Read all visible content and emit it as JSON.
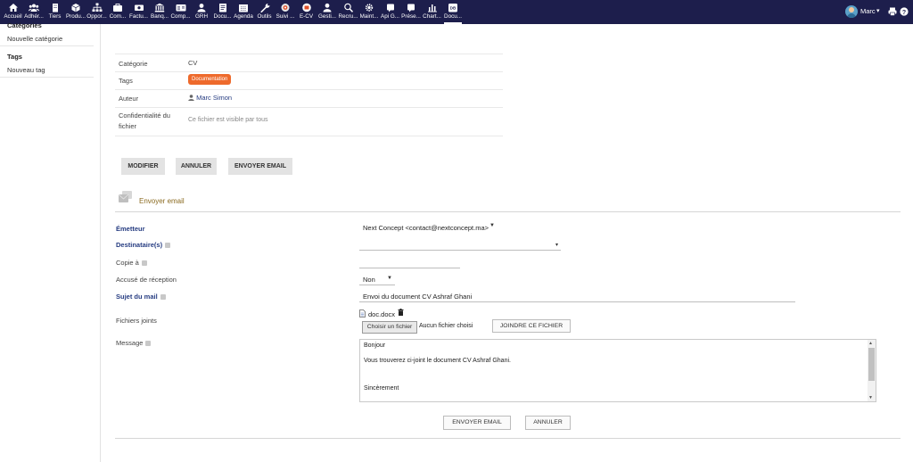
{
  "nav": {
    "items": [
      {
        "label": "Accueil",
        "icon": "home-icon"
      },
      {
        "label": "Adhér...",
        "icon": "members-icon"
      },
      {
        "label": "Tiers",
        "icon": "building-icon"
      },
      {
        "label": "Produ...",
        "icon": "cube-icon"
      },
      {
        "label": "Oppor...",
        "icon": "sitemap-icon"
      },
      {
        "label": "Com...",
        "icon": "briefcase-icon"
      },
      {
        "label": "Factu...",
        "icon": "invoice-icon"
      },
      {
        "label": "Banq...",
        "icon": "bank-icon"
      },
      {
        "label": "Comp...",
        "icon": "accounting-icon"
      },
      {
        "label": "GRH",
        "icon": "user-icon"
      },
      {
        "label": "Docu...",
        "icon": "folder-icon"
      },
      {
        "label": "Agenda",
        "icon": "calendar-icon"
      },
      {
        "label": "Outils",
        "icon": "wrench-icon"
      },
      {
        "label": "Suivi ...",
        "icon": "tracking-icon"
      },
      {
        "label": "E-CV",
        "icon": "cv-icon"
      },
      {
        "label": "Gesti...",
        "icon": "management-icon"
      },
      {
        "label": "Recru...",
        "icon": "search-person-icon"
      },
      {
        "label": "Maint...",
        "icon": "gear-icon"
      },
      {
        "label": "Api G...",
        "icon": "api-icon"
      },
      {
        "label": "Prése...",
        "icon": "presence-icon"
      },
      {
        "label": "Chart...",
        "icon": "chart-icon"
      },
      {
        "label": "Docu...",
        "icon": "document-icon"
      }
    ],
    "user": "Marc"
  },
  "leftmenu": {
    "categories_heading": "Catégories",
    "new_category": "Nouvelle catégorie",
    "tags_heading": "Tags",
    "new_tag": "Nouveau tag"
  },
  "info": {
    "category_label": "Catégorie",
    "category_value": "CV",
    "tags_label": "Tags",
    "tag_value": "Documentation",
    "author_label": "Auteur",
    "author_value": "Marc Simon",
    "confidentiality_label_1": "Confidentialité du",
    "confidentiality_label_2": "fichier",
    "confidentiality_value": "Ce fichier est visible par tous"
  },
  "actions": {
    "modify": "MODIFIER",
    "cancel": "ANNULER",
    "send_email": "ENVOYER EMAIL"
  },
  "email_form": {
    "title": "Envoyer email",
    "sender_label": "Émetteur",
    "sender_value": "Next Concept <contact@nextconcept.ma>",
    "recipients_label": "Destinataire(s)",
    "cc_label": "Copie à",
    "receipt_label": "Accusé de réception",
    "receipt_value": "Non",
    "subject_label": "Sujet du mail",
    "subject_value": "Envoi du document CV Ashraf Ghani",
    "attachments_label": "Fichiers joints",
    "attached_file": "doc.docx",
    "choose_file": "Choisir un fichier",
    "no_file": "Aucun fichier choisi",
    "attach_button": "JOINDRE CE FICHIER",
    "message_label": "Message",
    "message_lines": [
      "Bonjour",
      "Vous trouverez ci-joint le document CV Ashraf Ghani.",
      "Sincèrement"
    ],
    "send_button": "ENVOYER EMAIL",
    "cancel_button": "ANNULER"
  },
  "colors": {
    "topbar": "#1d1e4c",
    "tag": "#ee6a2c",
    "link": "#263c81"
  }
}
